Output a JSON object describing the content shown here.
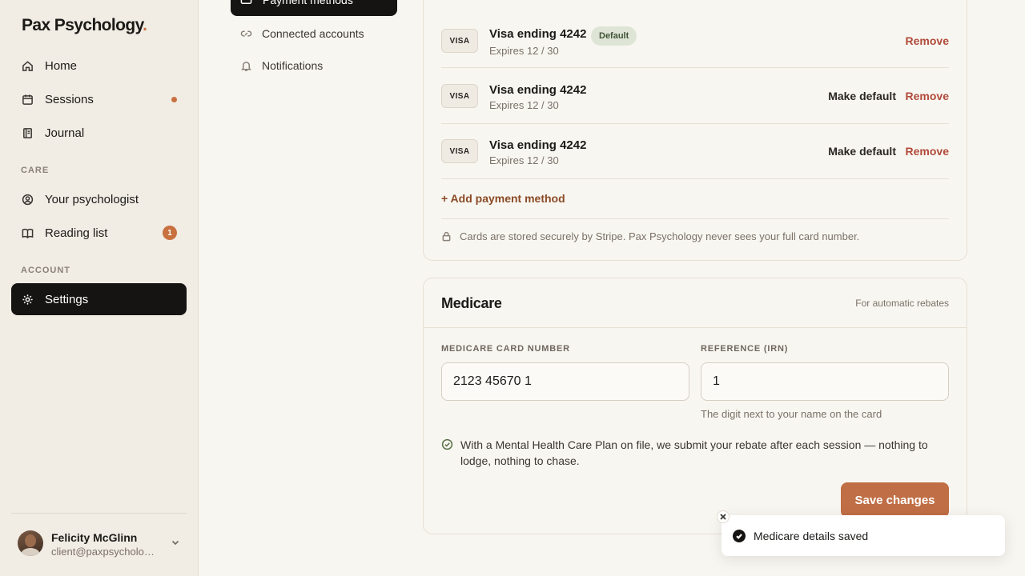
{
  "brand": {
    "name": "Pax Psychology",
    "dot": "."
  },
  "sidebar": {
    "items": [
      {
        "label": "Home",
        "icon": "home-icon"
      },
      {
        "label": "Sessions",
        "icon": "calendar-icon"
      },
      {
        "label": "Journal",
        "icon": "journal-icon"
      },
      {
        "label": "Your psychologist",
        "icon": "user-circle-icon"
      },
      {
        "label": "Reading list",
        "icon": "book-icon",
        "badge": "1"
      },
      {
        "label": "Settings",
        "icon": "gear-icon",
        "active": true
      }
    ],
    "sections": {
      "care": "CARE",
      "account": "ACCOUNT"
    }
  },
  "user": {
    "name": "Felicity McGlinn",
    "email": "client@paxpsychology.com"
  },
  "subnav": {
    "active": "Payment methods",
    "items": [
      {
        "label": "Connected accounts",
        "icon": "link-icon"
      },
      {
        "label": "Notifications",
        "icon": "bell-icon"
      }
    ]
  },
  "payment": {
    "cards": [
      {
        "brand": "VISA",
        "title": "Visa ending 4242",
        "expiry": "Expires 12 / 30",
        "default_label": "Default",
        "remove": "Remove"
      },
      {
        "brand": "VISA",
        "title": "Visa ending 4242",
        "expiry": "Expires 12 / 30",
        "make_default": "Make default",
        "remove": "Remove"
      },
      {
        "brand": "VISA",
        "title": "Visa ending 4242",
        "expiry": "Expires 12 / 30",
        "make_default": "Make default",
        "remove": "Remove"
      }
    ],
    "add_label": "+ Add payment method",
    "secure_note": "Cards are stored securely by Stripe. Pax Psychology never sees your full card number."
  },
  "medicare": {
    "title": "Medicare",
    "hint": "For automatic rebates",
    "card_label": "MEDICARE CARD NUMBER",
    "card_value": "2123 45670 1",
    "irn_label": "REFERENCE (IRN)",
    "irn_value": "1",
    "irn_help": "The digit next to your name on the card",
    "mhcp_note": "With a Mental Health Care Plan on file, we submit your rebate after each session — nothing to lodge, nothing to chase.",
    "save_label": "Save changes"
  },
  "toast": {
    "message": "Medicare details saved"
  },
  "colors": {
    "accent": "#c8703f",
    "active_bg": "#161412",
    "save_btn": "#c06e45",
    "remove": "#b04a3a"
  }
}
